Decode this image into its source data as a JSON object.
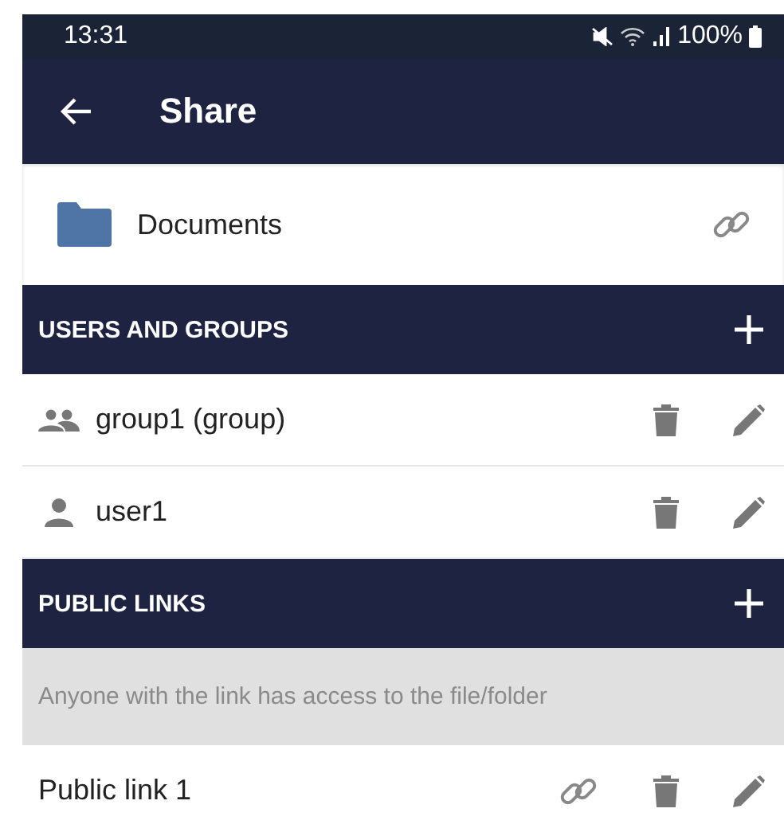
{
  "status_bar": {
    "time": "13:31",
    "battery": "100%"
  },
  "app_bar": {
    "title": "Share"
  },
  "file": {
    "name": "Documents"
  },
  "users_section": {
    "title": "USERS AND GROUPS",
    "items": [
      {
        "name": "group1 (group)",
        "kind": "group"
      },
      {
        "name": "user1",
        "kind": "user"
      }
    ]
  },
  "links_section": {
    "title": "PUBLIC LINKS",
    "hint": "Anyone with the link has access to the file/folder",
    "items": [
      {
        "name": "Public link 1"
      }
    ]
  }
}
